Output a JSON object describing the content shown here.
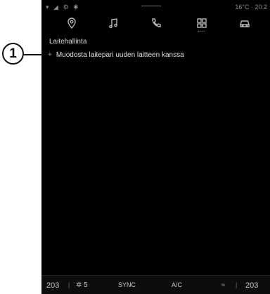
{
  "callout": {
    "number": "1"
  },
  "status": {
    "left_icons": "▾ ◢ ⚙ ✱",
    "temperature": "16°C",
    "clock": "20:2"
  },
  "nav": {
    "tabs": [
      "location-pin-icon",
      "music-note-icon",
      "phone-icon",
      "apps-grid-icon",
      "car-icon"
    ]
  },
  "page": {
    "title": "Laitehallinta",
    "items": [
      {
        "icon": "+",
        "label": "Muodosta laitepari uuden laitteen kanssa"
      }
    ]
  },
  "footer": {
    "left_temp": "203",
    "fan_speed": "5",
    "sync": "SYNC",
    "ac": "A/C",
    "right_temp": "203"
  }
}
